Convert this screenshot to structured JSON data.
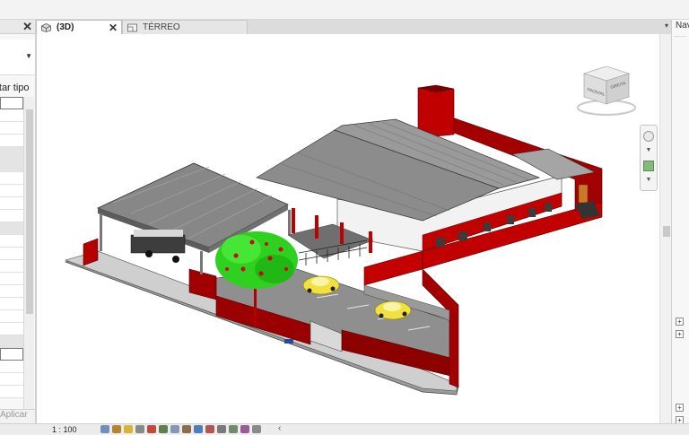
{
  "properties_panel": {
    "close_glyph": "✕",
    "edit_type_label": "litar tipo",
    "apply_label": "Aplicar"
  },
  "view_tabs": [
    {
      "label": "(3D)",
      "icon": "3d-view-icon",
      "active": true,
      "close_glyph": "✕"
    },
    {
      "label": "TÉRREO",
      "icon": "floor-plan-icon",
      "active": false
    }
  ],
  "view_tab_menu_glyph": "▾",
  "project_browser": {
    "title": "Nav"
  },
  "viewcube": {
    "faces": [
      "FRONTAL",
      "DIREITA"
    ]
  },
  "status_bar": {
    "scale": "1 : 100",
    "icons": [
      "detail-level-icon",
      "visual-style-icon",
      "sun-path-icon",
      "shadows-icon",
      "render-icon",
      "crop-view-icon",
      "show-crop-icon",
      "lock-view-icon",
      "temp-hide-icon",
      "reveal-hidden-icon",
      "worksharing-icon",
      "analytical-model-icon",
      "highlight-icon",
      "constraints-icon"
    ],
    "scroll_left_glyph": "‹"
  },
  "colors": {
    "wall_red": "#b50000",
    "wall_dark_red": "#7a0000",
    "roof_gray": "#8c8c8c",
    "facade_white": "#f2f2f2",
    "tree_green": "#33dd22",
    "car_yellow": "#f0e040"
  }
}
